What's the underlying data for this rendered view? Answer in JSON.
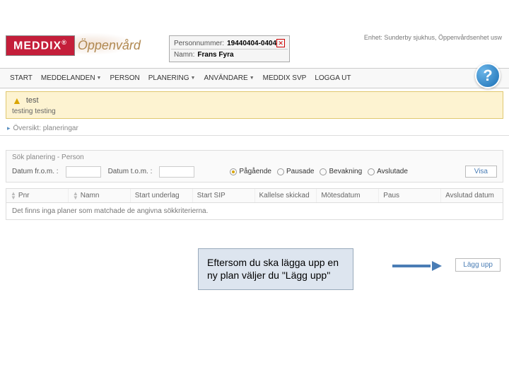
{
  "header": {
    "logo_text": "MEDDIX",
    "logo_suffix": "®",
    "logo_subtitle": "Öppenvård",
    "top_right_info": "Enhet: Sunderby sjukhus, Öppenvårdsenhet usw"
  },
  "person_box": {
    "pn_label": "Personnummer:",
    "pn_value": "19440404-0404",
    "name_label": "Namn:",
    "name_value": "Frans Fyra"
  },
  "nav": {
    "items": [
      {
        "label": "START",
        "dropdown": false
      },
      {
        "label": "MEDDELANDEN",
        "dropdown": true
      },
      {
        "label": "PERSON",
        "dropdown": false
      },
      {
        "label": "PLANERING",
        "dropdown": true
      },
      {
        "label": "ANVÄNDARE",
        "dropdown": true
      },
      {
        "label": "MEDDIX SVP",
        "dropdown": false
      },
      {
        "label": "LOGGA UT",
        "dropdown": false
      }
    ],
    "help": "?"
  },
  "notice": {
    "title": "test",
    "body": "testing testing"
  },
  "breadcrumb": {
    "text": "Översikt: planeringar"
  },
  "search": {
    "title": "Sök planering - Person",
    "from_label": "Datum fr.o.m. :",
    "to_label": "Datum t.o.m. :",
    "radios": [
      {
        "label": "Pågående",
        "selected": true
      },
      {
        "label": "Pausade",
        "selected": false
      },
      {
        "label": "Bevakning",
        "selected": false
      },
      {
        "label": "Avslutade",
        "selected": false
      }
    ],
    "visa_label": "Visa"
  },
  "table": {
    "columns": [
      "Pnr",
      "Namn",
      "Start underlag",
      "Start SIP",
      "Kallelse skickad",
      "Mötesdatum",
      "Paus",
      "Avslutad datum"
    ],
    "empty_text": "Det finns inga planer som matchade de angivna sökkriterierna."
  },
  "callout": {
    "text": "Eftersom du ska lägga upp en ny plan väljer du \"Lägg upp\""
  },
  "buttons": {
    "lagg_upp": "Lägg upp"
  }
}
